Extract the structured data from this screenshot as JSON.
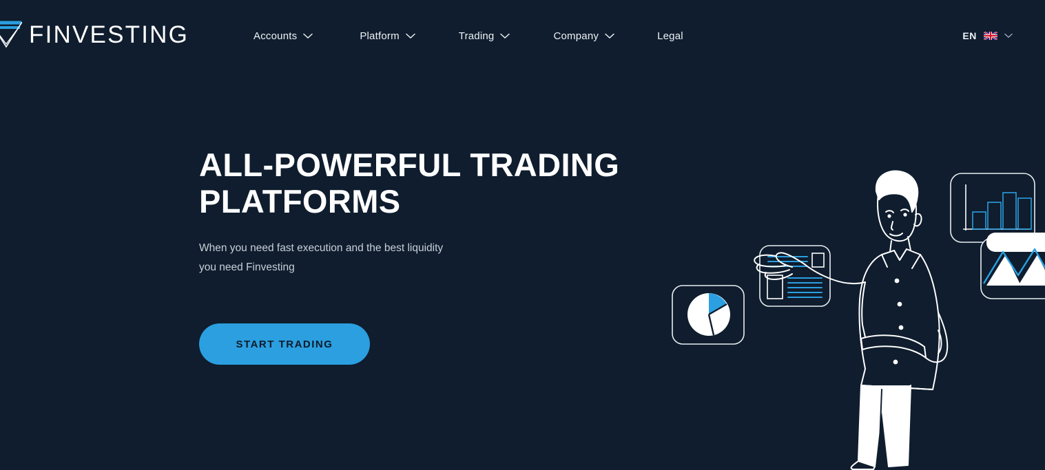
{
  "brand": {
    "logo_text": "FINVESTING",
    "logo_mark_icon": "triangle-chevron-logo-icon",
    "accent_color": "#2b9fe0",
    "background_color": "#0f1d2e"
  },
  "nav": {
    "items": [
      {
        "label": "Accounts",
        "has_dropdown": true,
        "icon": "chevron-down-icon"
      },
      {
        "label": "Platform",
        "has_dropdown": true,
        "icon": "chevron-down-icon"
      },
      {
        "label": "Trading",
        "has_dropdown": true,
        "icon": "chevron-down-icon"
      },
      {
        "label": "Company",
        "has_dropdown": true,
        "icon": "chevron-down-icon"
      },
      {
        "label": "Legal",
        "has_dropdown": false,
        "icon": ""
      }
    ]
  },
  "language": {
    "code": "EN",
    "flag_icon": "uk-flag-icon",
    "chevron_icon": "chevron-down-icon"
  },
  "hero": {
    "title_line_1": "ALL-POWERFUL TRADING",
    "title_line_2": "PLATFORMS",
    "subtitle_line_1": "When you need fast execution and the best liquidity",
    "subtitle_line_2": "you need Finvesting",
    "cta_label": "START TRADING"
  },
  "illustration": {
    "description": "line-art businessman presenting floating data cards",
    "cards": [
      {
        "name": "pie-chart-card",
        "icon": "pie-chart-icon"
      },
      {
        "name": "document-card",
        "icon": "document-lines-icon"
      },
      {
        "name": "bar-chart-card",
        "icon": "bar-chart-icon"
      },
      {
        "name": "mountain-chart-card",
        "icon": "area-chart-icon"
      }
    ]
  }
}
